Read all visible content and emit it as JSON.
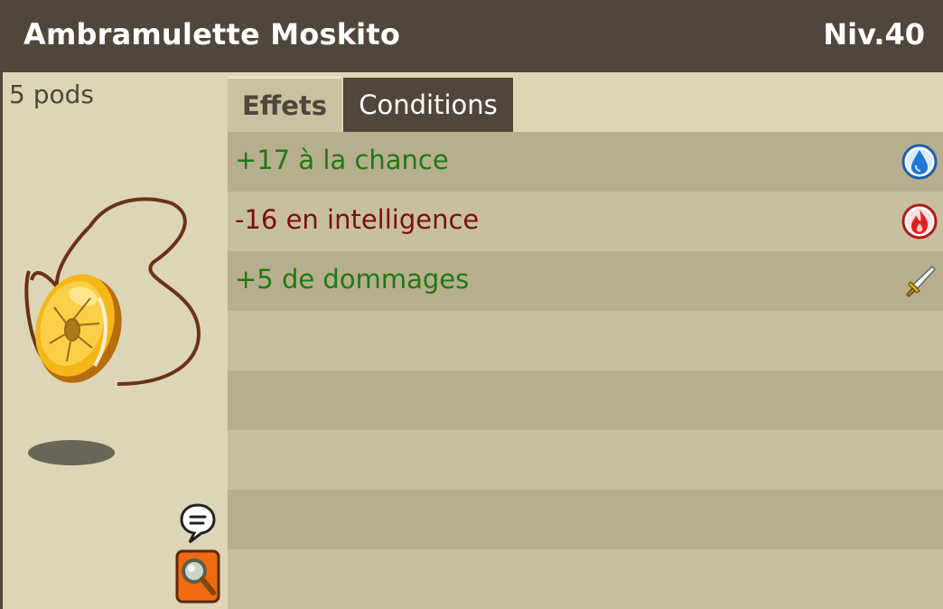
{
  "item": {
    "name": "Ambramulette Moskito",
    "level": "Niv.40",
    "weight": "5 pods"
  },
  "tabs": [
    {
      "label": "Effets",
      "active": true
    },
    {
      "label": "Conditions",
      "active": false
    }
  ],
  "effects": [
    {
      "text": "+17 à la chance",
      "color": "#1f7a12",
      "icon": "water-drop-icon"
    },
    {
      "text": "-16 en intelligence",
      "color": "#7a1010",
      "icon": "fire-icon"
    },
    {
      "text": "+5 de dommages",
      "color": "#1f7a12",
      "icon": "sword-icon"
    }
  ],
  "colors": {
    "titlebar": "#50473a",
    "panel": "#dcd6b6",
    "row_dark": "#b7ae8d",
    "row_light": "#c7bfa0",
    "positive": "#1f7a12",
    "negative": "#7a1010"
  }
}
